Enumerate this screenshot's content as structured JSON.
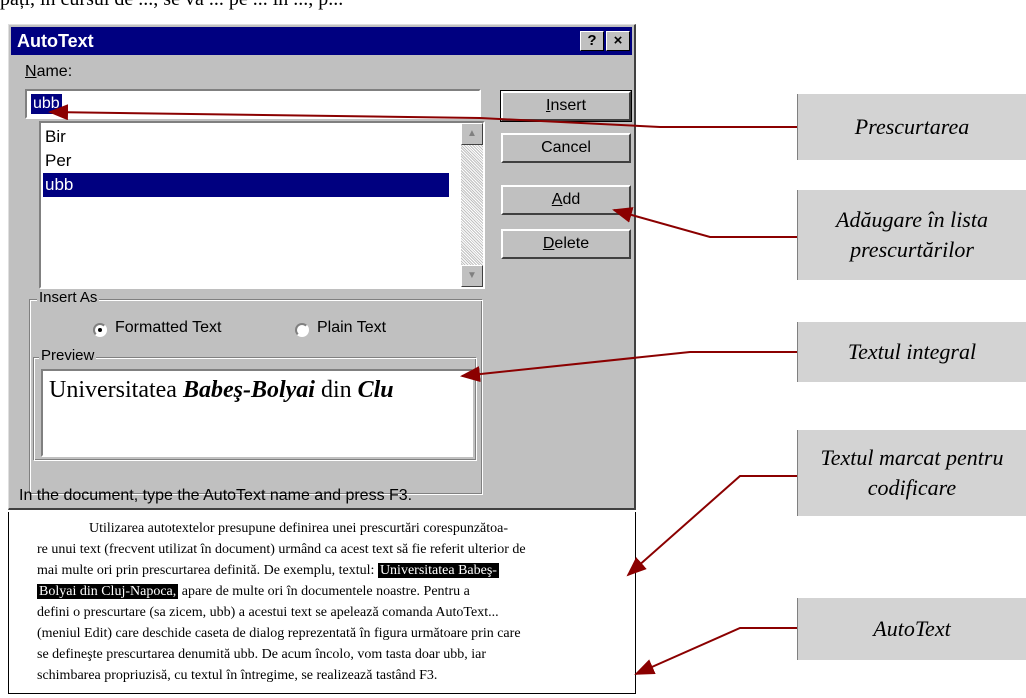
{
  "top_text": "pați, în cursul de ..., se va ... pe ... în ..., p...",
  "dialog": {
    "title": "AutoText",
    "help_btn": "?",
    "close_btn": "×",
    "name_label": "Name:",
    "name_value": "ubb",
    "list_items": [
      "Bir",
      "Per",
      "ubb"
    ],
    "selected_item": "ubb",
    "buttons": {
      "insert": "Insert",
      "cancel": "Cancel",
      "add": "Add",
      "delete": "Delete"
    },
    "insert_as": {
      "caption": "Insert As",
      "formatted": "Formatted Text",
      "plain": "Plain Text",
      "selected": "formatted"
    },
    "preview": {
      "caption": "Preview",
      "text_plain": "Universitatea ",
      "text_bold_italic": "Babeş-Bolyai",
      "text_mid": " din ",
      "text_tail": "Clu"
    },
    "hint": "In the document, type the AutoText name and press F3."
  },
  "document": {
    "lines": [
      "Utilizarea autotextelor presupune definirea unei prescurtări corespunzătoa-",
      "re unui text (frecvent utilizat în document) urmând ca acest text să fie referit ulterior de",
      "mai multe ori prin prescurtarea definită.  De exemplu, textul:",
      "apare de multe ori în documentele noastre.  Pentru a",
      "defini o prescurtare (sa zicem, ubb) a acestui text  se apelează comanda AutoText...",
      "(meniul Edit) care deschide caseta de dialog reprezentată în figura următoare prin care",
      "se defineşte prescurtarea denumită ubb.  De acum încolo, vom tasta doar ubb, iar",
      "schimbarea propriuzisă, cu textul în întregime, se realizează tastând F3."
    ],
    "highlight_1": "Universitatea Babeş-",
    "highlight_2": "Bolyai din Cluj-Napoca,"
  },
  "callouts": [
    "Prescurtarea",
    "Adăugare în lista prescurtărilor",
    "Textul integral",
    "Textul marcat pentru codificare",
    "AutoText"
  ],
  "colors": {
    "titlebar": "#000080",
    "dialog_bg": "#c0c0c0",
    "selection": "#000080",
    "callout_bg": "#d3d3d3",
    "arrow": "#8b0000"
  }
}
